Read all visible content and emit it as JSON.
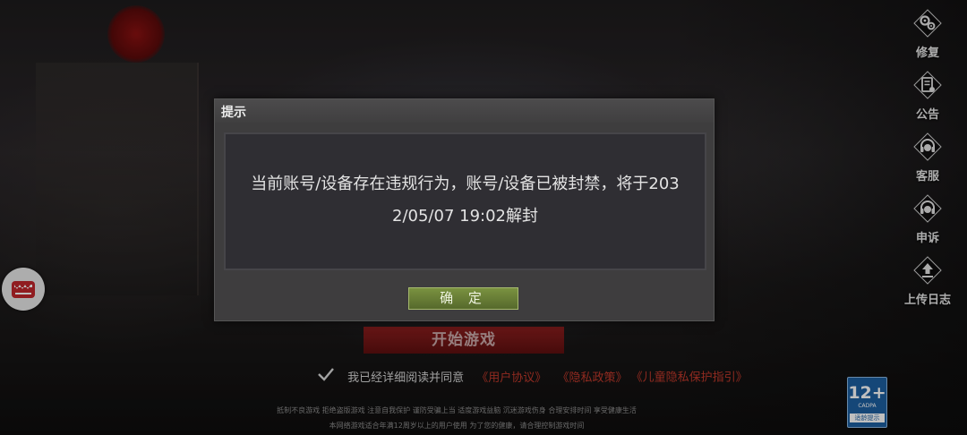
{
  "dialog": {
    "title": "提示",
    "message_line1": "当前账号/设备存在违规行为，账号/设备已被封禁，将于203",
    "message_line2": "2/05/07 19:02解封",
    "confirm_label": "确 定"
  },
  "side_menu": {
    "items": [
      {
        "label": "修复",
        "icon": "gears-icon"
      },
      {
        "label": "公告",
        "icon": "notice-icon"
      },
      {
        "label": "客服",
        "icon": "headset-icon"
      },
      {
        "label": "申诉",
        "icon": "appeal-headset-icon"
      },
      {
        "label": "上传日志",
        "icon": "upload-icon"
      }
    ]
  },
  "start": {
    "button_label": "开始游戏",
    "agree_text": "我已经详细阅读并同意",
    "links": [
      "《用户协议》",
      "《隐私政策》",
      "《儿童隐私保护指引》"
    ]
  },
  "health_notice": {
    "line1": "抵制不良游戏  拒绝盗版游戏  注意自我保护  谨防受骗上当  适度游戏益脑  沉迷游戏伤身  合理安排时间  享受健康生活",
    "line2": "本网络游戏适合年满12周岁以上的用户使用    为了您的健康，请合理控制游戏时间"
  },
  "age_rating": {
    "number": "12+",
    "org": "CADPA",
    "tip": "适龄提示"
  },
  "colors": {
    "dialog_bg": "#3e3d3e",
    "confirm_green": "#6b8236",
    "start_red": "#7a1a1a",
    "link_red": "#c0392b"
  }
}
